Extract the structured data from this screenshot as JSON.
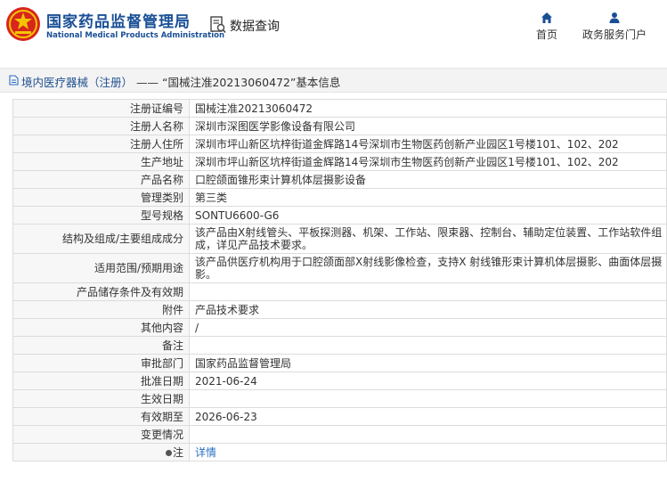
{
  "header": {
    "org_name_cn": "国家药品监督管理局",
    "org_name_en": "National Medical Products Administration",
    "section_title": "数据查询",
    "nav": {
      "home_label": "首页",
      "portal_label": "政务服务门户"
    }
  },
  "breadcrumb": {
    "category": "境内医疗器械（注册）",
    "separator": " —— ",
    "current": "“国械注准20213060472”基本信息"
  },
  "record": [
    {
      "label": "注册证编号",
      "value": "国械注准20213060472"
    },
    {
      "label": "注册人名称",
      "value": "深圳市深图医学影像设备有限公司"
    },
    {
      "label": "注册人住所",
      "value": "深圳市坪山新区坑梓街道金辉路14号深圳市生物医药创新产业园区1号楼101、102、202"
    },
    {
      "label": "生产地址",
      "value": "深圳市坪山新区坑梓街道金辉路14号深圳市生物医药创新产业园区1号楼101、102、202"
    },
    {
      "label": "产品名称",
      "value": "口腔颌面锥形束计算机体层摄影设备"
    },
    {
      "label": "管理类别",
      "value": "第三类"
    },
    {
      "label": "型号规格",
      "value": "SONTU6600-G6"
    },
    {
      "label": "结构及组成/主要组成成分",
      "value": "该产品由X射线管头、平板探测器、机架、工作站、限束器、控制台、辅助定位装置、工作站软件组成，详见产品技术要求。"
    },
    {
      "label": "适用范围/预期用途",
      "value": "该产品供医疗机构用于口腔颌面部X射线影像检查，支持X 射线锥形束计算机体层摄影、曲面体层摄影。"
    },
    {
      "label": "产品储存条件及有效期",
      "value": ""
    },
    {
      "label": "附件",
      "value": "产品技术要求"
    },
    {
      "label": "其他内容",
      "value": "/"
    },
    {
      "label": "备注",
      "value": ""
    },
    {
      "label": "审批部门",
      "value": "国家药品监督管理局"
    },
    {
      "label": "批准日期",
      "value": "2021-06-24"
    },
    {
      "label": "生效日期",
      "value": ""
    },
    {
      "label": "有效期至",
      "value": "2026-06-23"
    },
    {
      "label": "变更情况",
      "value": ""
    }
  ],
  "note": {
    "label": "注",
    "link_text": "详情"
  },
  "colors": {
    "brand_blue": "#1a4f96",
    "emblem_red": "#d7261e",
    "link_blue": "#2a6fc1"
  }
}
